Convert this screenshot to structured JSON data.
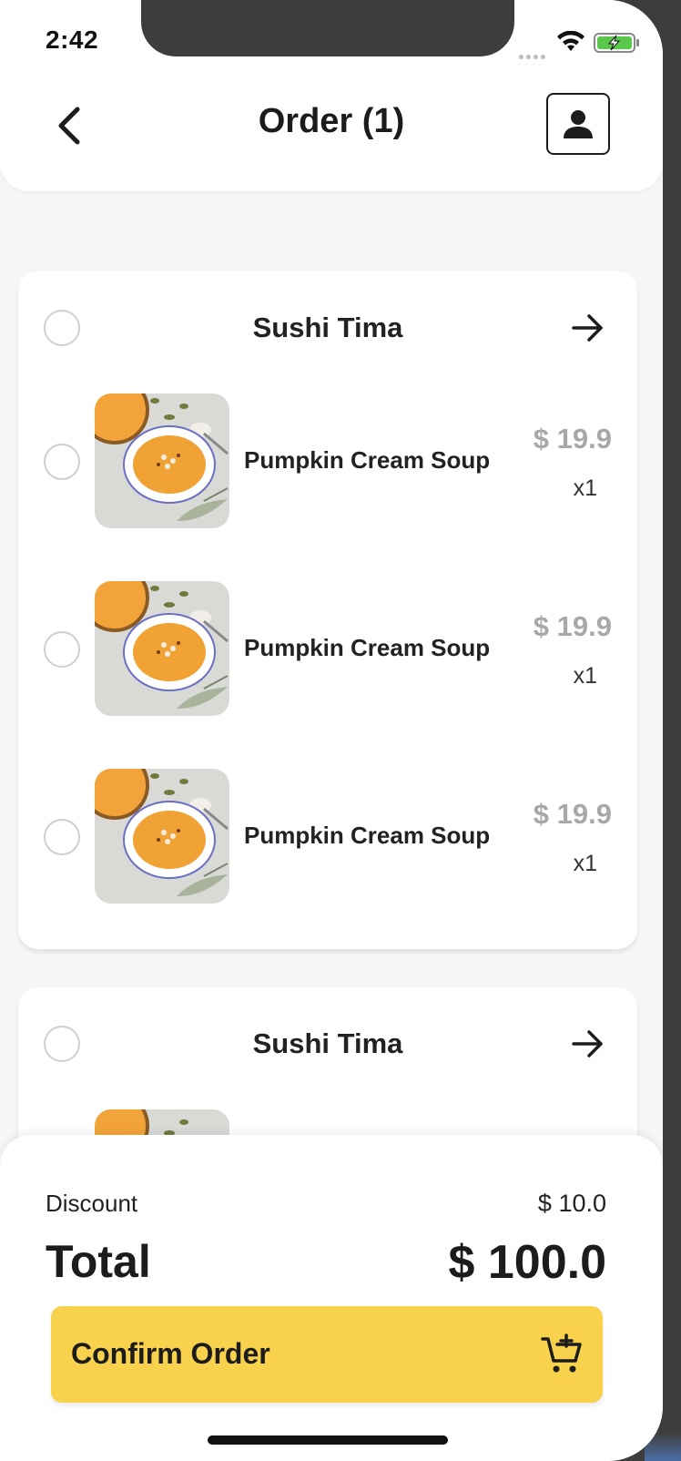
{
  "status_bar": {
    "time": "2:42"
  },
  "header": {
    "title": "Order (1)"
  },
  "stores": [
    {
      "name": "Sushi Tima",
      "items": [
        {
          "name": "Pumpkin Cream Soup",
          "price": "$ 19.9",
          "qty": "x1"
        },
        {
          "name": "Pumpkin Cream Soup",
          "price": "$ 19.9",
          "qty": "x1"
        },
        {
          "name": "Pumpkin Cream Soup",
          "price": "$ 19.9",
          "qty": "x1"
        }
      ]
    },
    {
      "name": "Sushi Tima",
      "items": []
    }
  ],
  "summary": {
    "discount_label": "Discount",
    "discount_value": "$ 10.0",
    "total_label": "Total",
    "total_value": "$ 100.0",
    "confirm_label": "Confirm Order"
  },
  "colors": {
    "accent": "#F8D24C",
    "price_gray": "#A8A8A8",
    "text_dark": "#1C1C1C"
  },
  "icons": {
    "back": "chevron-left-icon",
    "profile": "user-icon",
    "store_arrow": "arrow-right-icon",
    "cart": "cart-add-icon"
  }
}
